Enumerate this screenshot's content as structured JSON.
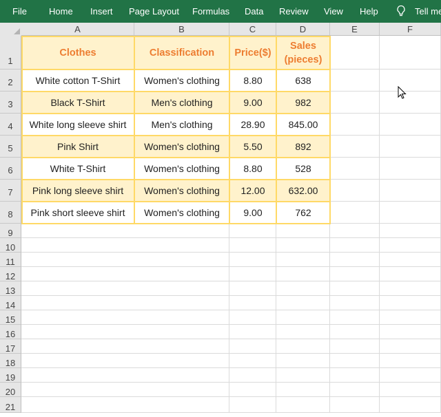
{
  "ribbon": {
    "tabs": [
      "File",
      "Home",
      "Insert",
      "Page Layout",
      "Formulas",
      "Data",
      "Review",
      "View",
      "Help"
    ],
    "tell_me": "Tell me"
  },
  "columns": [
    "A",
    "B",
    "C",
    "D",
    "E",
    "F"
  ],
  "rows": [
    "1",
    "2",
    "3",
    "4",
    "5",
    "6",
    "7",
    "8",
    "9",
    "10",
    "11",
    "12",
    "13",
    "14",
    "15",
    "16",
    "17",
    "18",
    "19",
    "20",
    "21"
  ],
  "table": {
    "headers": [
      "Clothes",
      "Classification",
      "Price($)",
      "Sales (pieces)"
    ],
    "rows": [
      [
        "White cotton T-Shirt",
        "Women's clothing",
        "8.80",
        "638"
      ],
      [
        "Black T-Shirt",
        "Men's clothing",
        "9.00",
        "982"
      ],
      [
        "White long sleeve shirt",
        "Men's clothing",
        "28.90",
        "845.00"
      ],
      [
        "Pink Shirt",
        "Women's clothing",
        "5.50",
        "892"
      ],
      [
        "White T-Shirt",
        "Women's clothing",
        "8.80",
        "528"
      ],
      [
        "Pink long sleeve shirt",
        "Women's clothing",
        "12.00",
        "632.00"
      ],
      [
        "Pink short sleeve shirt",
        "Women's clothing",
        "9.00",
        "762"
      ]
    ]
  },
  "colors": {
    "ribbon": "#217346",
    "header_text": "#ed7d31",
    "band_fill": "#fff2cc",
    "table_border": "#ffd966"
  }
}
